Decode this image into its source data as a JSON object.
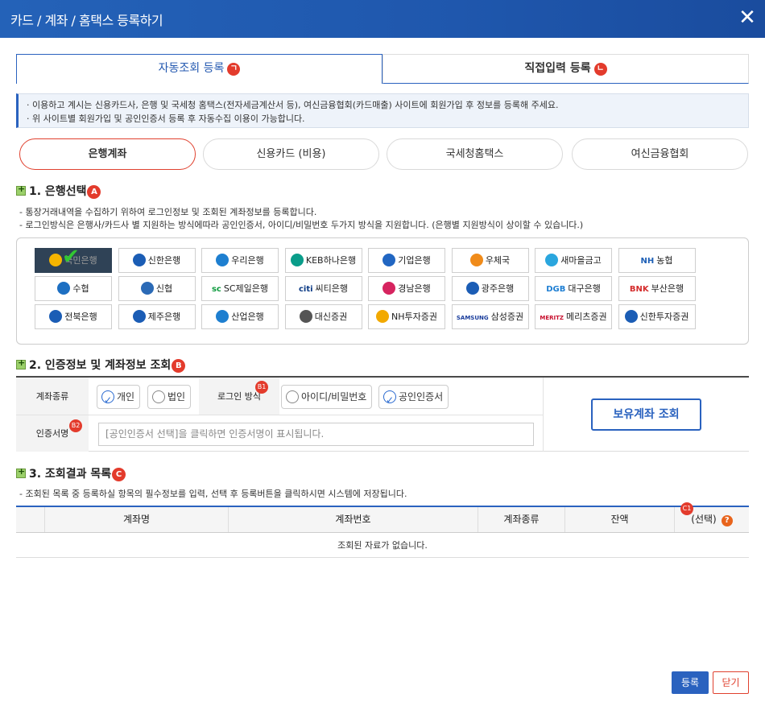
{
  "window": {
    "title": "카드 / 계좌 / 홈택스 등록하기",
    "close_icon": "close-icon"
  },
  "main_tabs": [
    {
      "label": "자동조회 등록",
      "badge": "ㄱ"
    },
    {
      "label": "직접입력 등록",
      "badge": "ㄴ"
    }
  ],
  "notice": [
    "· 이용하고 계시는 신용카드사, 은행 및 국세청 홈택스(전자세금계산서 등), 여신금융협회(카드매출) 사이트에 회원가입 후 정보를 등록해 주세요.",
    "· 위 사이트별 회원가입 및 공인인증서 등록 후 자동수집 이용이 가능합니다."
  ],
  "sub_tabs": [
    "은행계좌",
    "신용카드 (비용)",
    "국세청홈택스",
    "여신금융협회"
  ],
  "section1": {
    "title": "1. 은행선택",
    "badge": "A",
    "desc": [
      "- 통장거래내역을 수집하기 위하여 로그인정보 및 조회된 계좌정보를 등록합니다.",
      "- 로그인방식은 은행사/카드사 별 지원하는 방식에따라 공인인증서, 아이디/비밀번호 두가지 방식을 지원합니다. (은행별 지원방식이 상이할 수 있습니다.)"
    ],
    "banks": [
      {
        "label": "국민은행",
        "color": "#f5b400"
      },
      {
        "label": "신한은행",
        "color": "#1b5db5"
      },
      {
        "label": "우리은행",
        "color": "#1e7fd0"
      },
      {
        "label": "KEB하나은행",
        "color": "#0a9d8a"
      },
      {
        "label": "기업은행",
        "color": "#2166c2"
      },
      {
        "label": "우체국",
        "color": "#f08b1a"
      },
      {
        "label": "새마을금고",
        "color": "#2aa6de"
      },
      {
        "label": "농협",
        "prefix": "NH",
        "color": "#1d5fb6"
      },
      {
        "label": "수협",
        "color": "#1d6fc2"
      },
      {
        "label": "신협",
        "color": "#2b6ab6"
      },
      {
        "label": "SC제일은행",
        "prefix": "sc",
        "color": "#0f9b3f"
      },
      {
        "label": "씨티은행",
        "prefix": "citi",
        "color": "#0b3a85"
      },
      {
        "label": "경남은행",
        "color": "#d6245f"
      },
      {
        "label": "광주은행",
        "color": "#1b5db5"
      },
      {
        "label": "대구은행",
        "prefix": "DGB",
        "color": "#1f7fd3"
      },
      {
        "label": "부산은행",
        "prefix": "BNK",
        "color": "#d42b2b"
      },
      {
        "label": "전북은행",
        "color": "#1b5db5"
      },
      {
        "label": "제주은행",
        "color": "#1b5db5"
      },
      {
        "label": "산업은행",
        "color": "#1e7fd0"
      },
      {
        "label": "대신증권",
        "color": "#555555"
      },
      {
        "label": "NH투자증권",
        "color": "#f2a900"
      },
      {
        "label": "삼성증권",
        "prefix": "SAMSUNG",
        "color": "#1a3d9c"
      },
      {
        "label": "메리츠증권",
        "prefix": "MERITZ",
        "color": "#c8102e"
      },
      {
        "label": "신한투자증권",
        "color": "#1b5db5"
      }
    ]
  },
  "section2": {
    "title": "2. 인증정보 및 계좌정보 조회",
    "badge": "B",
    "account_type_label": "계좌종류",
    "account_types": [
      "개인",
      "법인"
    ],
    "login_method_label": "로그인 방식",
    "login_badge": "B1",
    "login_methods": [
      "아이디/비밀번호",
      "공인인증서"
    ],
    "cert_label": "인증서명",
    "cert_badge": "B2",
    "cert_placeholder": "[공인인증서 선택]을 클릭하면 인증서명이 표시됩니다.",
    "lookup_button": "보유계좌 조회"
  },
  "section3": {
    "title": "3. 조회결과 목록",
    "badge": "C",
    "desc": "- 조회된 목록 중 등록하실 항목의 필수정보를 입력, 선택 후 등록버튼을 클릭하시면 시스템에 저장됩니다.",
    "columns": [
      "계좌명",
      "계좌번호",
      "계좌종류",
      "잔액",
      "(선택)"
    ],
    "select_badge": "C1",
    "empty_message": "조회된 자료가 없습니다."
  },
  "footer": {
    "register": "등록",
    "close": "닫기"
  }
}
